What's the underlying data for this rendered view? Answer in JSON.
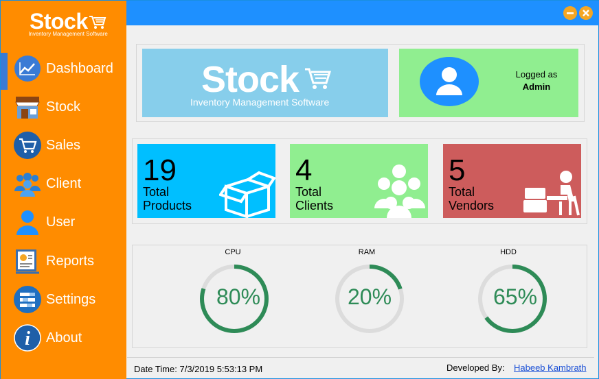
{
  "brand": {
    "name": "Stock",
    "tagline": "Inventory Management Software"
  },
  "sidebar": {
    "items": [
      {
        "label": "Dashboard",
        "icon": "chart-line-icon"
      },
      {
        "label": "Stock",
        "icon": "store-icon"
      },
      {
        "label": "Sales",
        "icon": "cart-icon"
      },
      {
        "label": "Client",
        "icon": "group-icon"
      },
      {
        "label": "User",
        "icon": "user-icon"
      },
      {
        "label": "Reports",
        "icon": "report-board-icon"
      },
      {
        "label": "Settings",
        "icon": "settings-list-icon"
      },
      {
        "label": "About",
        "icon": "info-icon"
      }
    ],
    "active": "Dashboard"
  },
  "window_controls": {
    "minimize": "minimize-icon",
    "close": "close-icon"
  },
  "user": {
    "logged_label": "Logged as",
    "name": "Admin"
  },
  "stats": [
    {
      "value": "19",
      "line1": "Total",
      "line2": "Products",
      "color": "#00bfff"
    },
    {
      "value": "4",
      "line1": "Total",
      "line2": "Clients",
      "color": "#90ee90"
    },
    {
      "value": "5",
      "line1": "Total",
      "line2": "Vendors",
      "color": "#cd5c5c"
    }
  ],
  "gauges": [
    {
      "title": "CPU",
      "value": "80%",
      "percent": 80
    },
    {
      "title": "RAM",
      "value": "20%",
      "percent": 20
    },
    {
      "title": "HDD",
      "value": "65%",
      "percent": 65
    }
  ],
  "footer": {
    "date_label": "Date Time:",
    "date_value": "7/3/2019 5:53:13 PM",
    "dev_label": "Developed By:",
    "dev_name": "Habeeb Kambrath"
  },
  "colors": {
    "sidebar": "#ff8c00",
    "topbar": "#1e90ff",
    "gauge_progress": "#2e8b57",
    "gauge_track": "#dcdcdc"
  }
}
